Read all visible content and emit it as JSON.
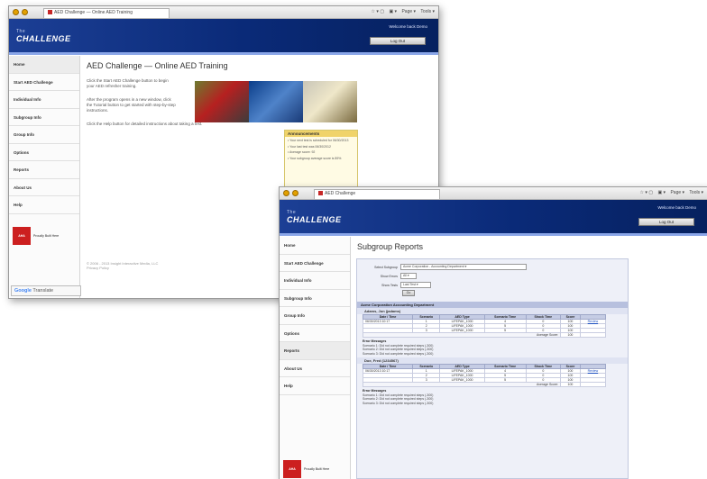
{
  "window1": {
    "tab_title": "AED Challenge — Online AED Training",
    "tools": [
      "☆ ▾ ▢",
      "▣ ▾",
      "Page ▾",
      "Tools ▾"
    ],
    "banner": {
      "logo_small": "The",
      "logo": "CHALLENGE",
      "welcome": "Welcome back Demo",
      "logout": "Log Out"
    },
    "sidebar": [
      "Home",
      "Start AED Challenge",
      "Individual Info",
      "Subgroup Info",
      "Group Info",
      "Options",
      "Reports",
      "About Us",
      "Help"
    ],
    "cert_badge": "AHA",
    "cert_text": "Proudly Built Here",
    "page_title": "AED Challenge — Online AED Training",
    "para1": "Click the Start AED Challenge button to begin your AED refresher training.",
    "para2": "After the program opens in a new window, click the Tutorial button to get started with step-by-step instructions.",
    "para3": "Click the Help button for detailed instructions about taking a test.",
    "announcements": {
      "title": "Announcements",
      "items": [
        "Your next test is scheduled for 06/30/2013",
        "Your last test was 06/30/2012",
        "Average score: 92",
        "Your subgroup average score is 89%"
      ]
    },
    "footer": [
      "© 2006 - 2013 Insight Interactive Media, LLC",
      "Privacy Policy"
    ],
    "translate": {
      "g": "Google",
      "label": "Translate"
    }
  },
  "window2": {
    "tab_title": "AED Challenge",
    "tools": [
      "☆ ▾ ▢",
      "▣ ▾",
      "Page ▾",
      "Tools ▾"
    ],
    "banner": {
      "logo_small": "The",
      "logo": "CHALLENGE",
      "welcome": "Welcome back Demo",
      "logout": "Log Out"
    },
    "sidebar": [
      "Home",
      "Start AED Challenge",
      "Individual Info",
      "Subgroup Info",
      "Group Info",
      "Options",
      "Reports",
      "About Us",
      "Help"
    ],
    "cert_text": "Proudly Built Here",
    "page_title": "Subgroup Reports",
    "filters": [
      {
        "label": "Select Subgroup",
        "value": "Acme Corporation - Accounting Department ▾"
      },
      {
        "label": "Show Errors",
        "value": "All ▾"
      },
      {
        "label": "Show Tests",
        "value": "Last Test ▾"
      }
    ],
    "go": "Go",
    "dept": "Acme Corporation Accounting Department",
    "columns": [
      "Date / Time",
      "Scenario",
      "AED Type",
      "Scenario Time",
      "Shock Time",
      "Score",
      ""
    ],
    "users": [
      {
        "name": "Adams, Jon (jadams)",
        "rows": [
          [
            "06/30/2013 10:17",
            "1",
            "LIFEPAK_1000",
            "4",
            "0",
            "100",
            "Review"
          ],
          [
            "",
            "2",
            "LIFEPAK_1000",
            "5",
            "0",
            "100",
            ""
          ],
          [
            "",
            "3",
            "LIFEPAK_1000",
            "5",
            "0",
            "100",
            ""
          ]
        ],
        "avg_label": "Average Score:",
        "avg": "100",
        "msg_title": "Error Messages",
        "messages": [
          "Scenario 1: Did not complete required steps (-300)",
          "Scenario 2: Did not complete required steps (-300)",
          "Scenario 3: Did not complete required steps (-300)"
        ]
      },
      {
        "name": "Doe, Fred (1234567)",
        "rows": [
          [
            "06/30/2013 10:17",
            "1",
            "LIFEPAK_1000",
            "4",
            "0",
            "100",
            "Review"
          ],
          [
            "",
            "2",
            "LIFEPAK_1000",
            "5",
            "0",
            "100",
            ""
          ],
          [
            "",
            "3",
            "LIFEPAK_1000",
            "5",
            "0",
            "100",
            ""
          ]
        ],
        "avg_label": "Average Score:",
        "avg": "100",
        "msg_title": "Error Messages",
        "messages": [
          "Scenario 1: Did not complete required steps (-300)",
          "Scenario 2: Did not complete required steps (-300)",
          "Scenario 3: Did not complete required steps (-300)"
        ]
      }
    ]
  }
}
